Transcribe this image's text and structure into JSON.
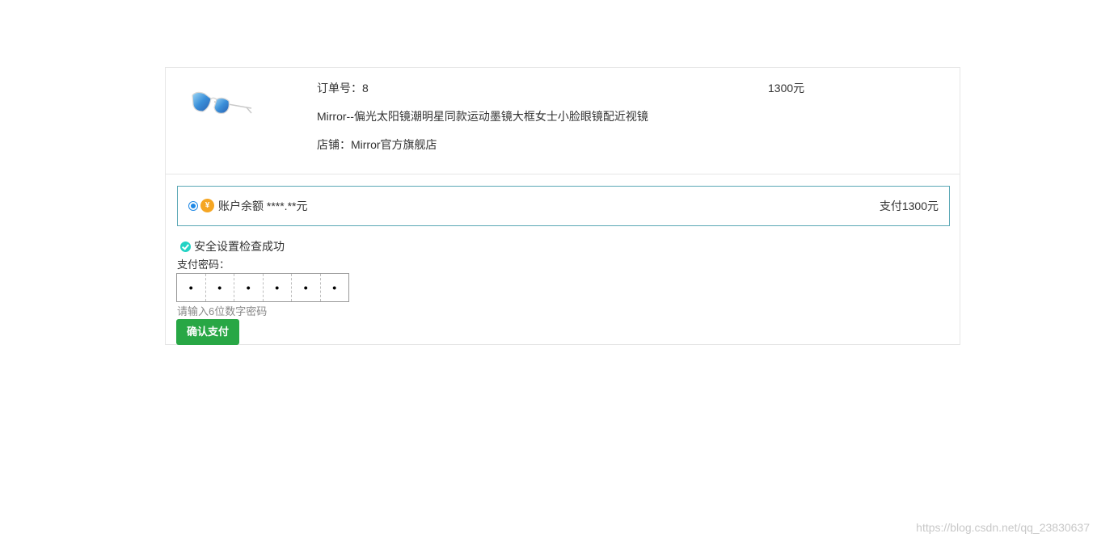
{
  "order": {
    "order_no_label": "订单号：8",
    "title": "Mirror--偏光太阳镜潮明星同款运动墨镜大框女士小脸眼镜配近视镜",
    "shop_label": "店铺：Mirror官方旗舰店",
    "price": "1300元",
    "product_image_icon": "sunglasses-image"
  },
  "payment": {
    "coin_symbol": "¥",
    "balance_label": "账户余额 ****.**元",
    "pay_amount": "支付1300元",
    "selected": true
  },
  "security": {
    "check_text": "安全设置检查成功",
    "check_icon": "check-circle-icon"
  },
  "password": {
    "label": "支付密码：",
    "cells": [
      "•",
      "•",
      "•",
      "•",
      "•",
      "•"
    ],
    "hint": "请输入6位数字密码"
  },
  "confirm_button": {
    "label": "确认支付",
    "color": "#28a745"
  },
  "watermark": "https://blog.csdn.net/qq_23830637"
}
